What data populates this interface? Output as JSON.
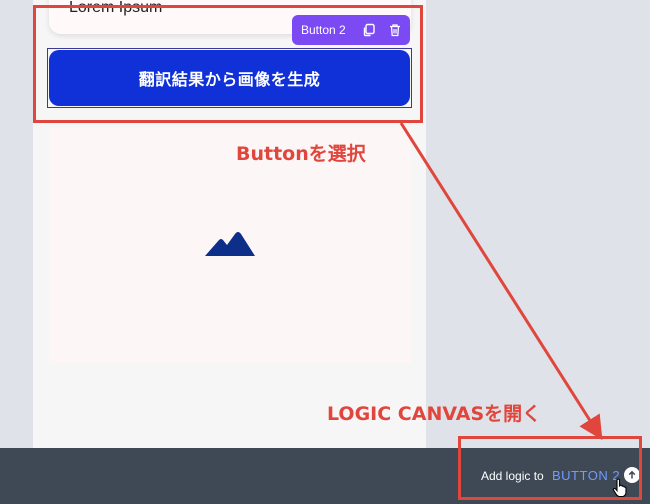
{
  "canvas": {
    "card_text": "Lorem Ipsum",
    "toolbar_label": "Button 2",
    "generate_button_label": "翻訳結果から画像を生成"
  },
  "bottom_bar": {
    "add_logic_label": "Add logic to",
    "add_logic_target": "BUTTON 2"
  },
  "annotations": {
    "select_button_note": "Buttonを選択",
    "open_logic_canvas_note": "LOGIC CANVASを開く",
    "color": "#e0463c"
  },
  "icons": {
    "duplicate": "copy-icon",
    "delete": "trash-icon",
    "image": "mountain-image-icon",
    "expand": "arrow-up-icon",
    "cursor": "hand-pointer-icon"
  }
}
